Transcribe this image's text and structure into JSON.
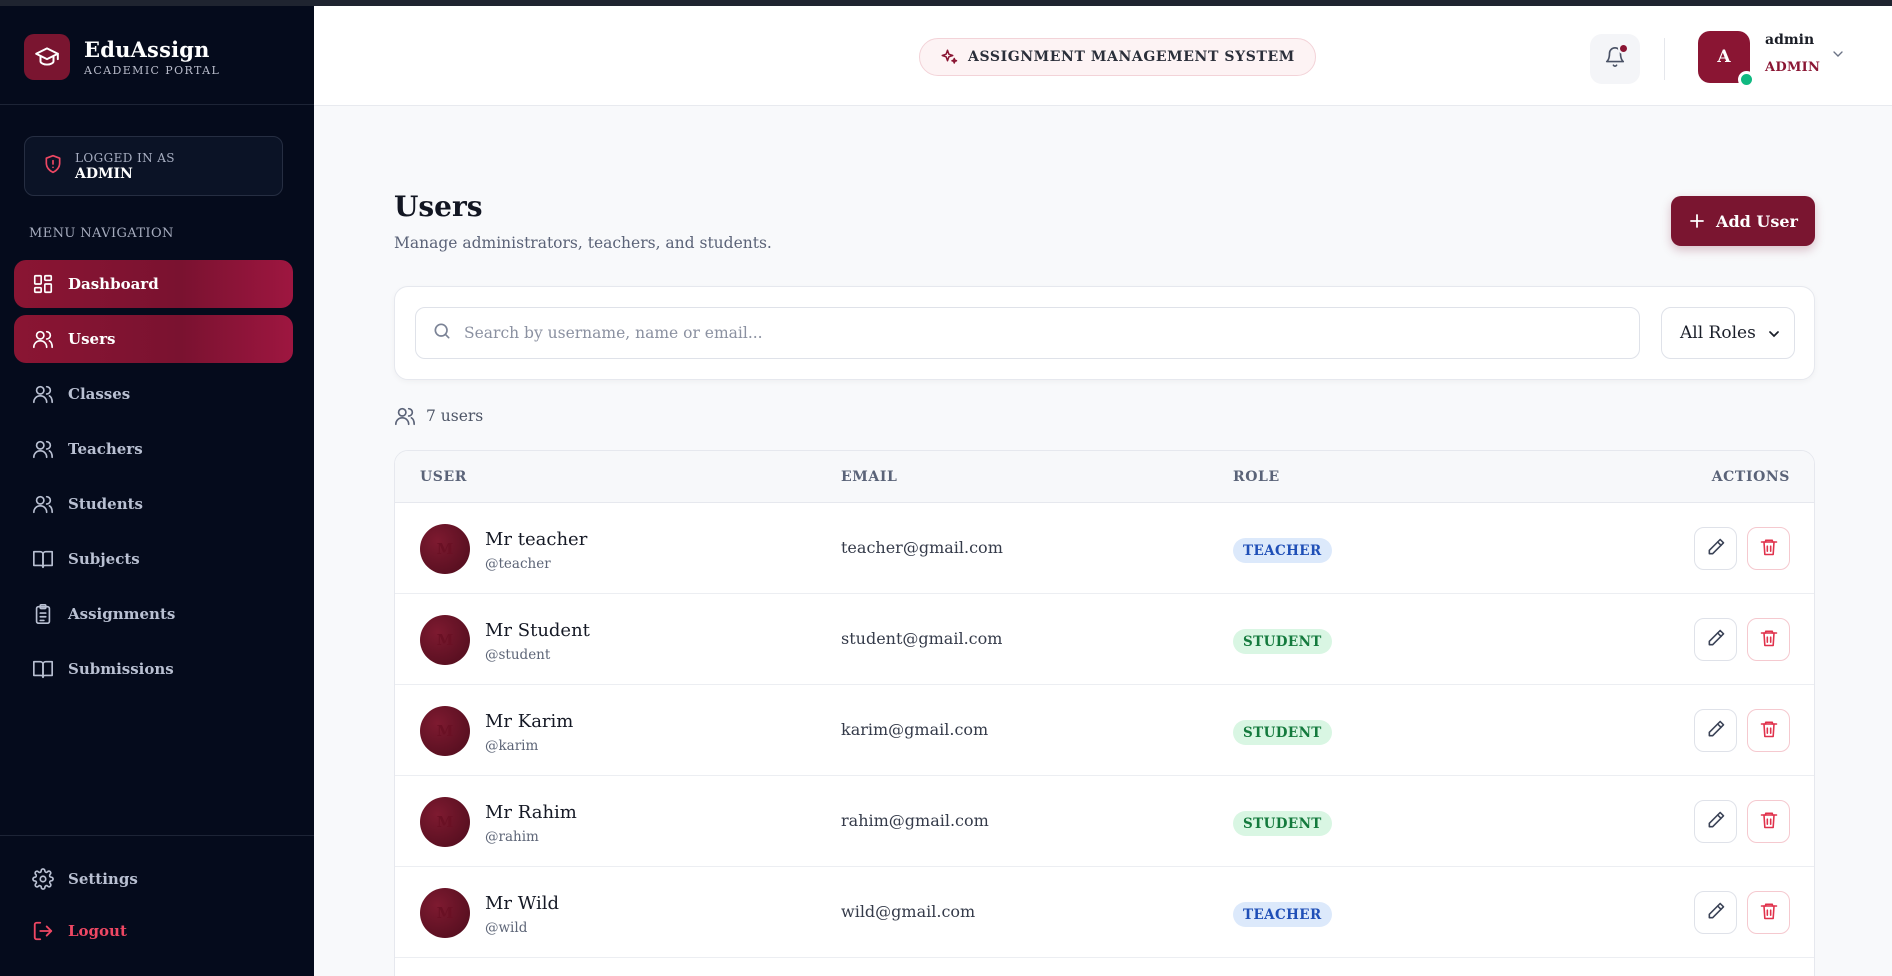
{
  "brand": {
    "title": "EduAssign",
    "subtitle": "ACADEMIC PORTAL"
  },
  "session": {
    "label": "LOGGED IN AS",
    "role": "ADMIN"
  },
  "sidebar": {
    "menu_title": "MENU NAVIGATION",
    "items": [
      {
        "label": "Dashboard",
        "icon": "dashboard-icon",
        "active": true
      },
      {
        "label": "Users",
        "icon": "users-icon",
        "active": true
      },
      {
        "label": "Classes",
        "icon": "users-icon",
        "active": false
      },
      {
        "label": "Teachers",
        "icon": "users-icon",
        "active": false
      },
      {
        "label": "Students",
        "icon": "users-icon",
        "active": false
      },
      {
        "label": "Subjects",
        "icon": "book-icon",
        "active": false
      },
      {
        "label": "Assignments",
        "icon": "clipboard-icon",
        "active": false
      },
      {
        "label": "Submissions",
        "icon": "book-icon",
        "active": false
      }
    ],
    "settings_label": "Settings",
    "logout_label": "Logout"
  },
  "header": {
    "system_label": "ASSIGNMENT MANAGEMENT SYSTEM",
    "user": {
      "initial": "A",
      "name": "admin",
      "role": "ADMIN",
      "online": true
    }
  },
  "page": {
    "title": "Users",
    "subtitle": "Manage administrators, teachers, and students.",
    "add_button": "Add User",
    "search_placeholder": "Search by username, name or email...",
    "role_filter": "All Roles",
    "count_text": "7 users"
  },
  "table": {
    "columns": [
      "USER",
      "EMAIL",
      "ROLE",
      "ACTIONS"
    ],
    "rows": [
      {
        "initial": "M",
        "name": "Mr teacher",
        "handle": "@teacher",
        "email": "teacher@gmail.com",
        "role": "TEACHER"
      },
      {
        "initial": "M",
        "name": "Mr Student",
        "handle": "@student",
        "email": "student@gmail.com",
        "role": "STUDENT"
      },
      {
        "initial": "M",
        "name": "Mr Karim",
        "handle": "@karim",
        "email": "karim@gmail.com",
        "role": "STUDENT"
      },
      {
        "initial": "M",
        "name": "Mr Rahim",
        "handle": "@rahim",
        "email": "rahim@gmail.com",
        "role": "STUDENT"
      },
      {
        "initial": "M",
        "name": "Mr Wild",
        "handle": "@wild",
        "email": "wild@gmail.com",
        "role": "TEACHER"
      }
    ]
  },
  "colors": {
    "brand": "#7a1530",
    "sidebar_bg": "#050b1c",
    "teacher_badge": "#1f4fb7",
    "student_badge": "#147a3d",
    "danger": "#e0314b",
    "online": "#10b981"
  }
}
